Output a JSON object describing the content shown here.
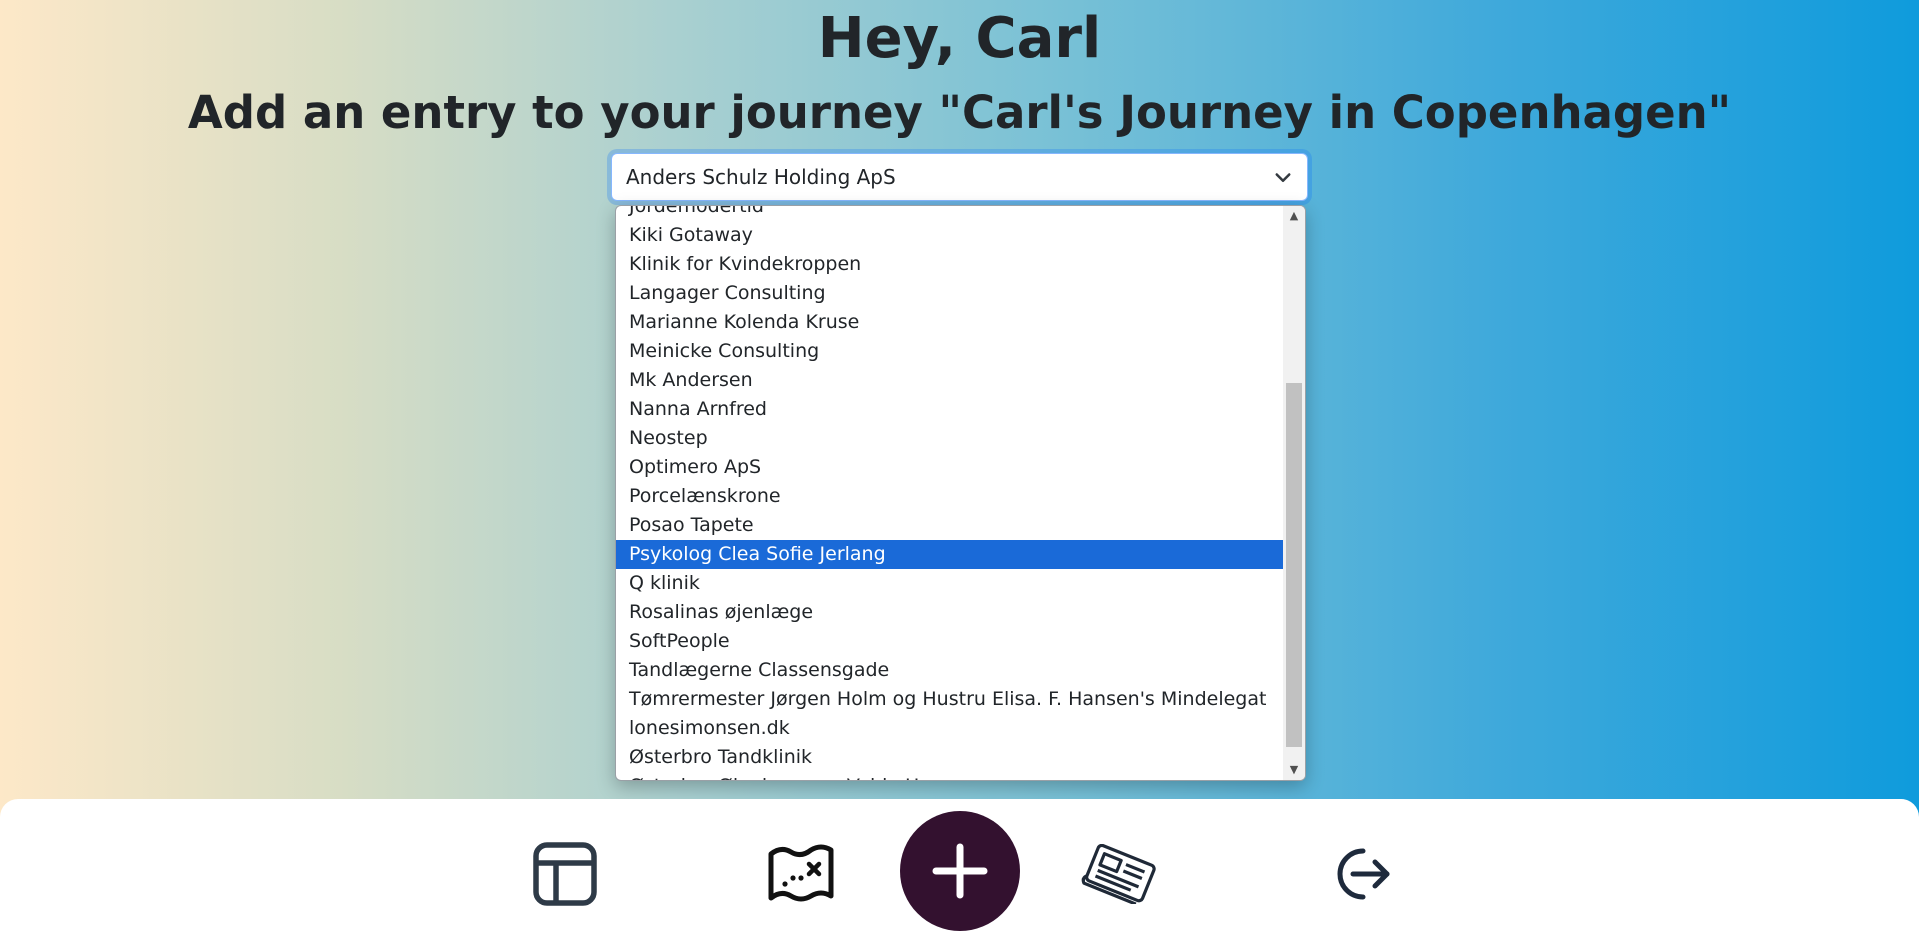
{
  "header": {
    "greeting": "Hey, Carl",
    "subtitle": "Add an entry to your journey \"Carl's Journey in Copenhagen\""
  },
  "select": {
    "value": "Anders Schulz Holding ApS",
    "options": [
      "Jordemodertid",
      "Kiki Gotaway",
      "Klinik for Kvindekroppen",
      "Langager Consulting",
      "Marianne Kolenda Kruse",
      "Meinicke Consulting",
      "Mk Andersen",
      "Nanna Arnfred",
      "Neostep",
      "Optimero ApS",
      "Porcelænskrone",
      "Posao Tapete",
      "Psykolog Clea Sofie Jerlang",
      "Q klinik",
      "Rosalinas øjenlæge",
      "SoftPeople",
      "Tandlægerne Classensgade",
      "Tømrermester Jørgen Holm og Hustru Elisa. F. Hansen's Mindelegat",
      "lonesimonsen.dk",
      "Østerbro Tandklinik",
      "Østerbro Øjenlægerne Vaida Herm"
    ],
    "highlighted_option": "Psykolog Clea Sofie Jerlang"
  },
  "nav": {
    "items": [
      {
        "icon": "dashboard-layout-icon"
      },
      {
        "icon": "treasure-map-icon"
      },
      {
        "icon": "plus-icon"
      },
      {
        "icon": "newspaper-icon"
      },
      {
        "icon": "logout-icon"
      }
    ],
    "accent_color": "#33112f"
  },
  "colors": {
    "highlight": "#1a6ad8"
  }
}
